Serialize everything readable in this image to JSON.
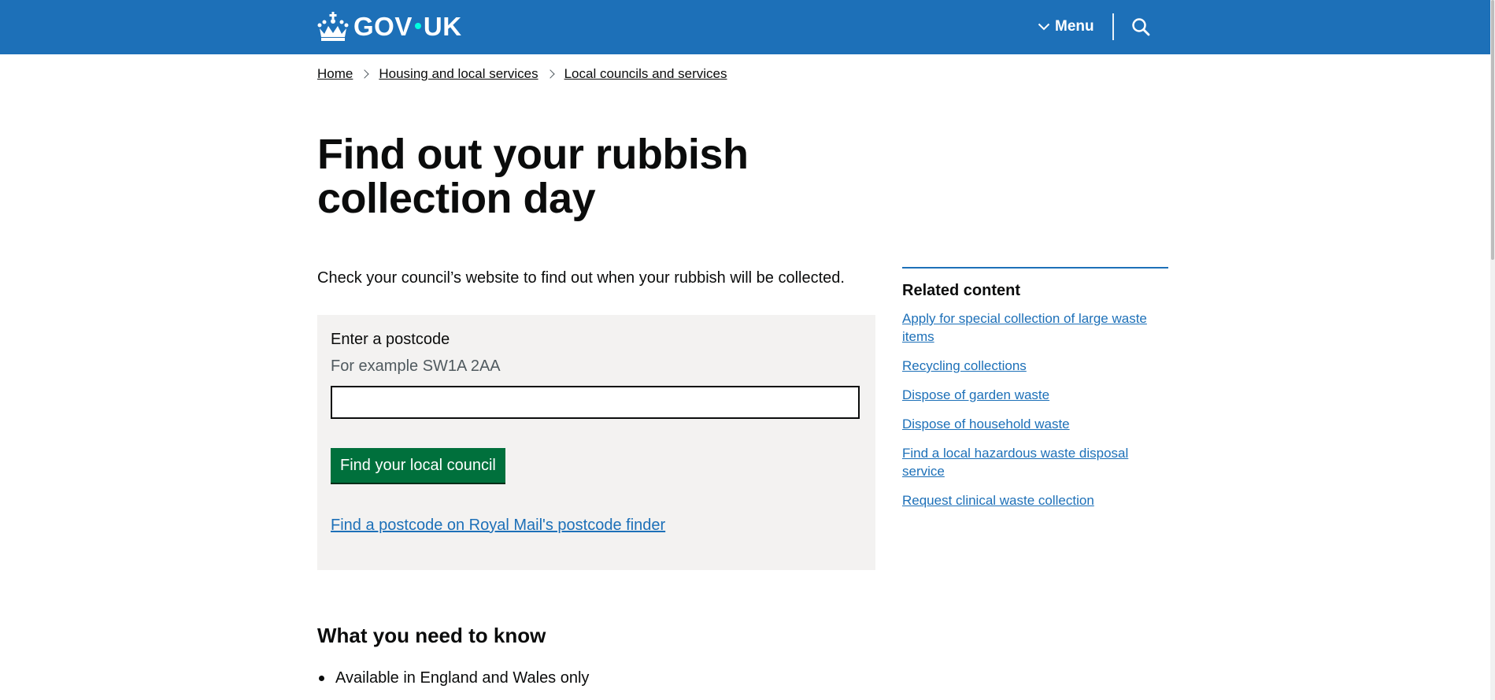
{
  "header": {
    "logo_part1": "GOV",
    "logo_part2": "UK",
    "menu_label": "Menu",
    "search_icon": "search-icon",
    "brand_color": "#1d70b8"
  },
  "breadcrumb": {
    "items": [
      "Home",
      "Housing and local services",
      "Local councils and services"
    ]
  },
  "main": {
    "title": "Find out your rubbish collection day",
    "intro": "Check your council’s website to find out when your rubbish will be collected.",
    "form": {
      "label": "Enter a postcode",
      "hint": "For example SW1A 2AA",
      "value": "",
      "button_label": "Find your local council",
      "button_color": "#00703c",
      "postcode_finder_link": "Find a postcode on Royal Mail's postcode finder"
    },
    "needs": {
      "heading": "What you need to know",
      "items": [
        "Available in England and Wales only"
      ]
    }
  },
  "related": {
    "heading": "Related content",
    "links": [
      "Apply for special collection of large waste items",
      "Recycling collections",
      "Dispose of garden waste",
      "Dispose of household waste",
      "Find a local hazardous waste disposal service",
      "Request clinical waste collection"
    ]
  }
}
